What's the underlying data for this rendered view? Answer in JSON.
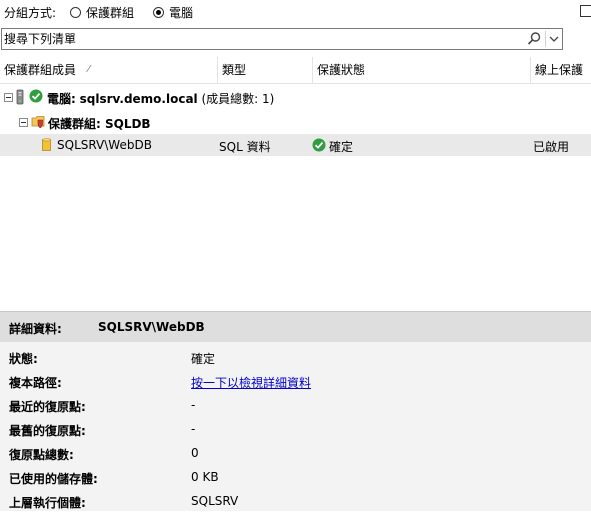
{
  "groupby": {
    "label": "分組方式:",
    "options": [
      {
        "label": "保護群組",
        "selected": false
      },
      {
        "label": "電腦",
        "selected": true
      }
    ]
  },
  "search": {
    "placeholder": "搜尋下列清單"
  },
  "columns": [
    "保護群組成員",
    "類型",
    "保護狀態",
    "線上保護"
  ],
  "tree": {
    "computer": {
      "prefix": "電腦:",
      "name": "sqlsrv.demo.local",
      "member_count": "(成員總數: 1)"
    },
    "group": {
      "label": "保護群組: SQLDB"
    },
    "item": {
      "name": "SQLSRV\\WebDB",
      "type": "SQL 資料",
      "status": "確定",
      "online": "已啟用"
    }
  },
  "details": {
    "header_label": "詳細資料:",
    "header_value": "SQLSRV\\WebDB",
    "rows": [
      {
        "key": "狀態:",
        "value": "確定"
      },
      {
        "key": "複本路徑:",
        "value": "按一下以檢視詳細資料"
      },
      {
        "key": "最近的復原點:",
        "value": "-"
      },
      {
        "key": "最舊的復原點:",
        "value": "-"
      },
      {
        "key": "復原點總數:",
        "value": "0"
      },
      {
        "key": "已使用的儲存體:",
        "value": "0 KB"
      },
      {
        "key": "上層執行個體:",
        "value": "SQLSRV"
      }
    ]
  },
  "colors": {
    "ok_green": "#2e9e3e",
    "link_blue": "#0000cc",
    "folder_yellow": "#f1c232"
  },
  "icons": [
    "computer-icon",
    "status-ok-icon",
    "protection-group-icon",
    "database-icon",
    "search-icon",
    "dropdown-icon"
  ]
}
